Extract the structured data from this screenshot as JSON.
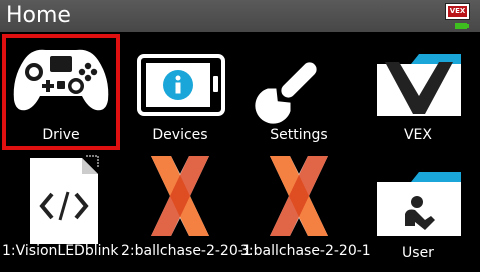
{
  "header": {
    "title": "Home",
    "badge_text": "VEX"
  },
  "row1": [
    {
      "label": "Drive",
      "icon": "gamepad-icon",
      "selected": true
    },
    {
      "label": "Devices",
      "icon": "devices-info-icon"
    },
    {
      "label": "Settings",
      "icon": "wrench-icon"
    },
    {
      "label": "VEX",
      "icon": "vex-folder-icon"
    }
  ],
  "row2": [
    {
      "label": "1:VisionLEDblink",
      "icon": "code-file-icon"
    },
    {
      "label": "2:ballchase-2-20-1",
      "icon": "vex-x-logo-icon"
    },
    {
      "label": "3:ballchase-2-20-1",
      "icon": "vex-x-logo-icon"
    },
    {
      "label": "User",
      "icon": "user-folder-icon"
    }
  ],
  "colors": {
    "selection": "#e01010",
    "titlebar": "#4e4e4e",
    "battery": "#3fbf1f",
    "accent_blue": "#1aa6d8",
    "vex_orange": "#f26b21"
  }
}
